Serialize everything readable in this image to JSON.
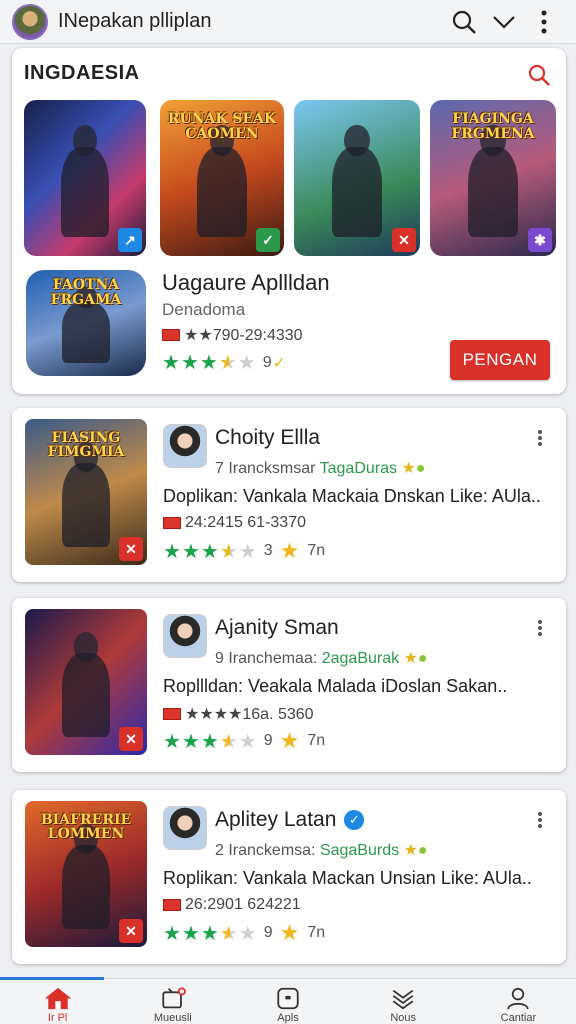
{
  "topbar": {
    "title": "INepakan plliplan",
    "icons": [
      "avatar",
      "search-icon",
      "chevron-down-icon",
      "more-vert-icon"
    ]
  },
  "featured": {
    "heading": "INGDAESIA",
    "thumbnails": [
      {
        "title": "",
        "badge": "↗",
        "badge_color": "#1e88e5"
      },
      {
        "title": "RUNAK SEAK CAOMEN",
        "badge": "✓",
        "badge_color": "#2a9a4a"
      },
      {
        "title": "",
        "badge": "✕",
        "badge_color": "#d9302a"
      },
      {
        "title": "FIAGINGA FRGMENA",
        "badge": "✱",
        "badge_color": "#7a4ad0"
      }
    ],
    "app": {
      "icon_title": "FAOTNA FRGAMA",
      "title": "Uagaure Apllldan",
      "developer": "Denadoma",
      "meta": "★★790-29:4330",
      "rating": 3.5,
      "rating_count": "9",
      "install_label": "PENGAN"
    }
  },
  "cards": [
    {
      "thumb_title": "FIASING FIMGMIA",
      "title": "Choity Ellla",
      "verified": false,
      "sub_prefix": "7 Irancksmsar",
      "sub_green": "TagaDuras",
      "description": "Doplikan: Vankala Mackaia Dnskan Like: AUla..",
      "meta": "24:2415 61-3370",
      "rating": 3.5,
      "rating_count": "3",
      "extra": "7n"
    },
    {
      "thumb_title": "",
      "title": "Ajanity Sman",
      "verified": false,
      "sub_prefix": "9 Iranchemaa:",
      "sub_green": "2agaBurak",
      "description": "Ropllldan: Veakala Malada iDoslan Sakan..",
      "meta": "★★★★16a. 5360",
      "rating": 3.5,
      "rating_count": "9",
      "extra": "7n"
    },
    {
      "thumb_title": "BIAFRERIE LOMMEN",
      "title": "Aplitey Latan",
      "verified": true,
      "sub_prefix": "2 Iranckemsa:",
      "sub_green": "SagaBurds",
      "description": "Roplikan: Vankala Mackan Unsian Like: AUla..",
      "meta": "26:2901 624221",
      "rating": 3.5,
      "rating_count": "9",
      "extra": "7n"
    }
  ],
  "bottomnav": {
    "items": [
      {
        "label": "Ir Pl",
        "icon": "home-icon",
        "active": true
      },
      {
        "label": "Mueusli",
        "icon": "tv-icon",
        "active": false
      },
      {
        "label": "Apls",
        "icon": "apps-icon",
        "active": false
      },
      {
        "label": "Nous",
        "icon": "news-icon",
        "active": false
      },
      {
        "label": "Cantiar",
        "icon": "profile-icon",
        "active": false
      }
    ]
  },
  "colors": {
    "accent": "#d9302a",
    "rating_green": "#1aa34a",
    "link_blue": "#2a78d8"
  }
}
